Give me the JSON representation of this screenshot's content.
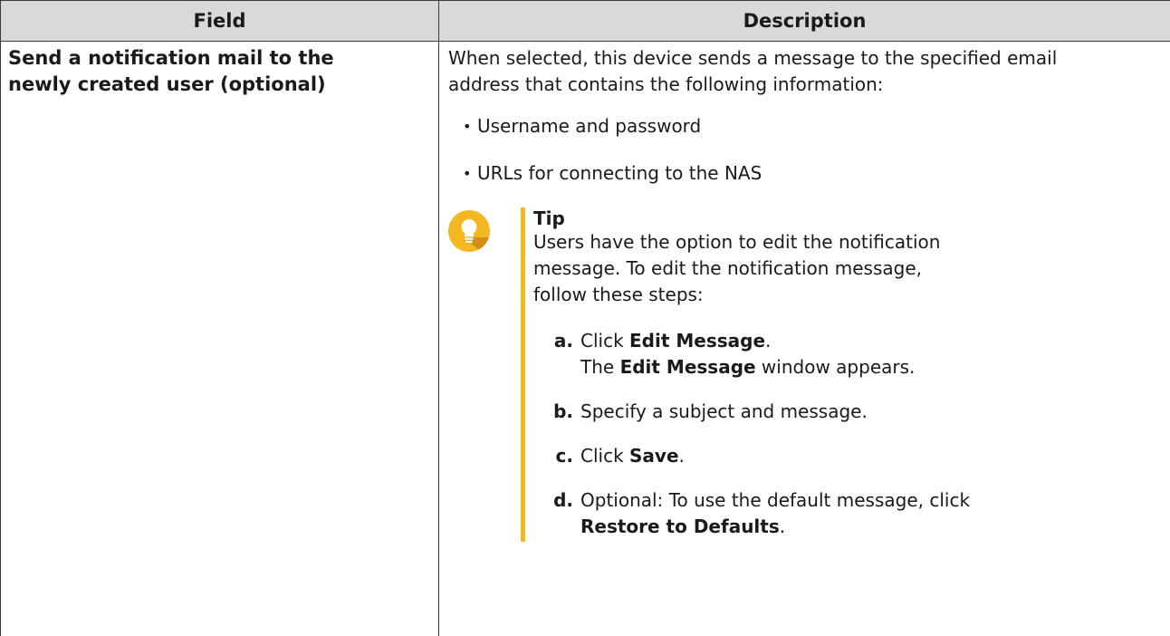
{
  "table": {
    "headers": {
      "field": "Field",
      "description": "Description"
    },
    "row": {
      "field_line1": "Send a notification mail to the",
      "field_line2": "newly created user (optional)",
      "intro_line1": "When selected, this device sends a message to the specified email",
      "intro_line2": "address that contains the following information:",
      "bullets": [
        "Username and password",
        "URLs for connecting to the NAS"
      ],
      "tip": {
        "icon": "lightbulb-icon",
        "icon_color": "#f5b71f",
        "title": "Tip",
        "text": "Users have the option to edit the notification message. To edit the notification message, follow these steps:",
        "steps": [
          {
            "letter": "a.",
            "pre": "Click ",
            "bold": "Edit Message",
            "post": ".",
            "line2_pre": "The ",
            "line2_bold": "Edit Message",
            "line2_post": " window appears."
          },
          {
            "letter": "b.",
            "text": "Specify a subject and message."
          },
          {
            "letter": "c.",
            "pre": "Click ",
            "bold": "Save",
            "post": "."
          },
          {
            "letter": "d.",
            "pre": "Optional: To use the default message, click",
            "bold": "Restore to Defaults",
            "post": "."
          }
        ]
      }
    }
  }
}
